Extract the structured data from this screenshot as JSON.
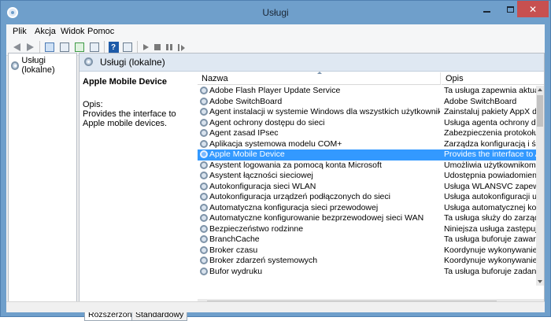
{
  "window": {
    "title": "Usługi",
    "controls": {
      "minimize": "",
      "maximize": "",
      "close": "✕"
    }
  },
  "menu": [
    "Plik",
    "Akcja",
    "Widok",
    "Pomoc"
  ],
  "toolbar": {
    "buttons": [
      "back-arrow-icon",
      "forward-arrow-icon",
      "console-tree-icon",
      "properties-icon",
      "refresh-icon",
      "export-icon",
      "help-icon",
      "mmc-icon",
      "start-service-icon",
      "stop-service-icon",
      "pause-service-icon",
      "restart-service-icon"
    ],
    "help_label": "?"
  },
  "tree": {
    "item": "Usługi (lokalne)"
  },
  "main": {
    "title": "Usługi (lokalne)",
    "description": {
      "name": "Apple Mobile Device",
      "label": "Opis:",
      "text": "Provides the interface to Apple mobile devices."
    },
    "columns": {
      "name": "Nazwa",
      "desc": "Opis"
    },
    "rows": [
      {
        "name": "Adobe Flash Player Update Service",
        "desc": "Ta usługa zapewnia aktualności",
        "selected": false
      },
      {
        "name": "Adobe SwitchBoard",
        "desc": "Adobe SwitchBoard",
        "selected": false
      },
      {
        "name": "Agent instalacji w systemie Windows dla wszystkich użytkowników",
        "desc": "Zainstaluj pakiety AppX dla wszys",
        "selected": false
      },
      {
        "name": "Agent ochrony dostępu do sieci",
        "desc": "Usługa agenta ochrony dostępu",
        "selected": false
      },
      {
        "name": "Agent zasad IPsec",
        "desc": "Zabezpieczenia protokołu inter",
        "selected": false
      },
      {
        "name": "Aplikacja systemowa modelu COM+",
        "desc": "Zarządza konfiguracją i śledzen",
        "selected": false
      },
      {
        "name": "Apple Mobile Device",
        "desc": "Provides the interface to Apple",
        "selected": true
      },
      {
        "name": "Asystent logowania za pomocą konta Microsoft",
        "desc": "Umożliwia użytkownikom logo",
        "selected": false
      },
      {
        "name": "Asystent łączności sieciowej",
        "desc": "Udostępnia powiadomienia o s",
        "selected": false
      },
      {
        "name": "Autokonfiguracja sieci WLAN",
        "desc": "Usługa WLANSVC zapewnia lo",
        "selected": false
      },
      {
        "name": "Autokonfiguracja urządzeń podłączonych do sieci",
        "desc": "Usługa autokonfiguracji urząd",
        "selected": false
      },
      {
        "name": "Automatyczna konfiguracja sieci przewodowej",
        "desc": "Usługa automatycznej konfigu",
        "selected": false
      },
      {
        "name": "Automatyczne konfigurowanie bezprzewodowej sieci WAN",
        "desc": "Ta usługa służy do zarządzani",
        "selected": false
      },
      {
        "name": "Bezpieczeństwo rodzinne",
        "desc": "Niniejsza usługa zastępuje fun",
        "selected": false
      },
      {
        "name": "BranchCache",
        "desc": "Ta usługa buforuje zawartość s",
        "selected": false
      },
      {
        "name": "Broker czasu",
        "desc": "Koordynuje wykonywanie prac",
        "selected": false
      },
      {
        "name": "Broker zdarzeń systemowych",
        "desc": "Koordynuje wykonywanie prac",
        "selected": false
      },
      {
        "name": "Bufor wydruku",
        "desc": "Ta usługa buforuje zadania dr",
        "selected": false
      }
    ],
    "tabs": [
      "Rozszerzony",
      "Standardowy"
    ]
  }
}
